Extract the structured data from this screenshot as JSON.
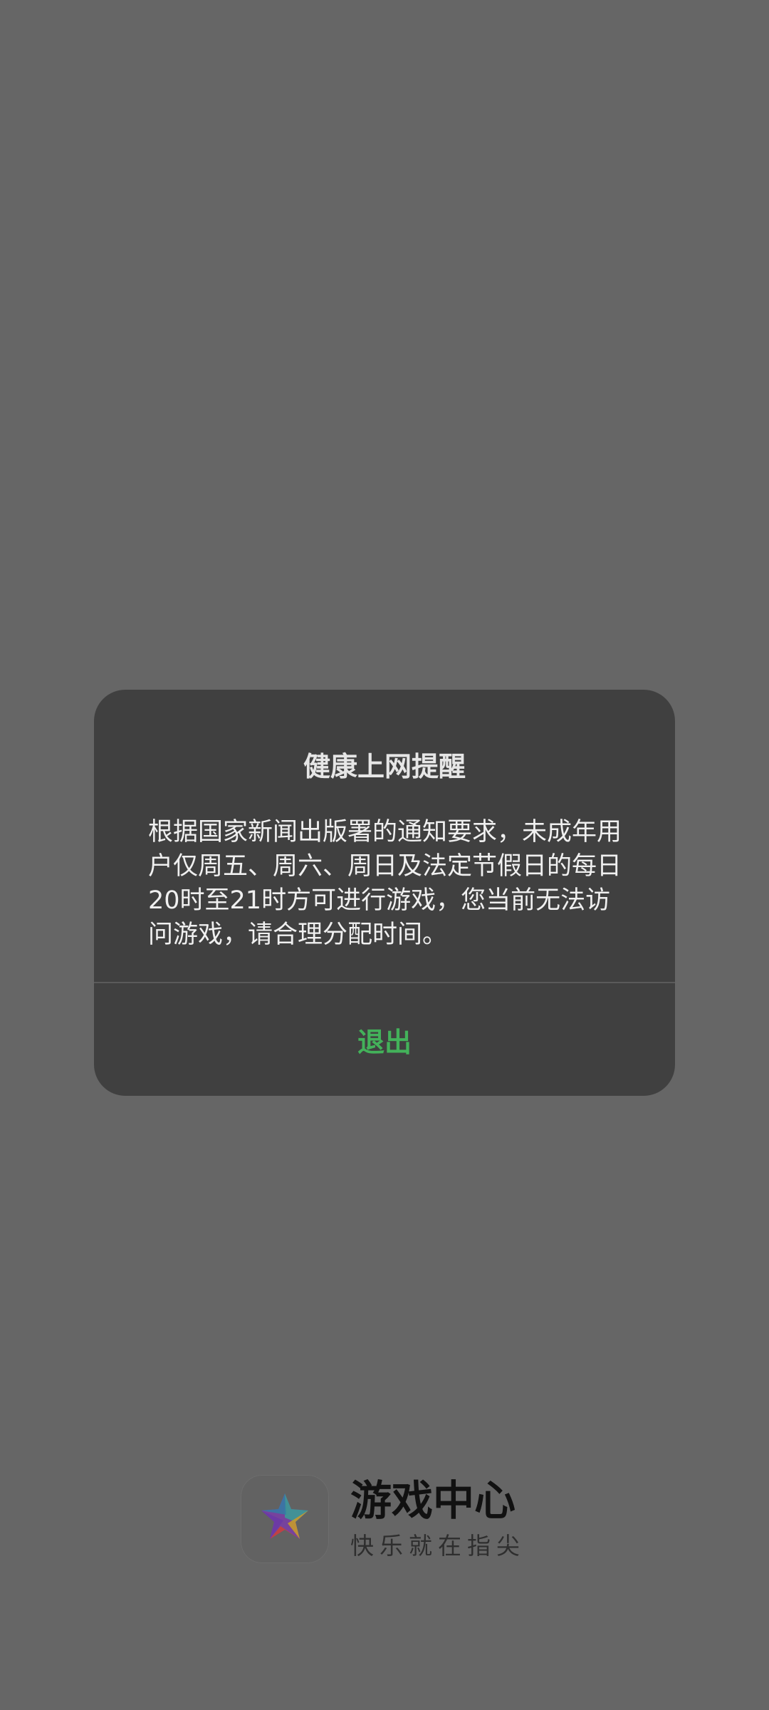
{
  "dialog": {
    "title": "健康上网提醒",
    "message": "根据国家新闻出版署的通知要求，未成年用户仅周五、周六、周日及法定节假日的每日20时至21时方可进行游戏，您当前无法访问游戏，请合理分配时间。",
    "exit_label": "退出"
  },
  "brand": {
    "name": "游戏中心",
    "slogan": "快乐就在指尖",
    "logo_icon": "colorful-star-icon"
  },
  "colors": {
    "background": "#666666",
    "dialog_background": "#404040",
    "accent": "#43b25a"
  }
}
